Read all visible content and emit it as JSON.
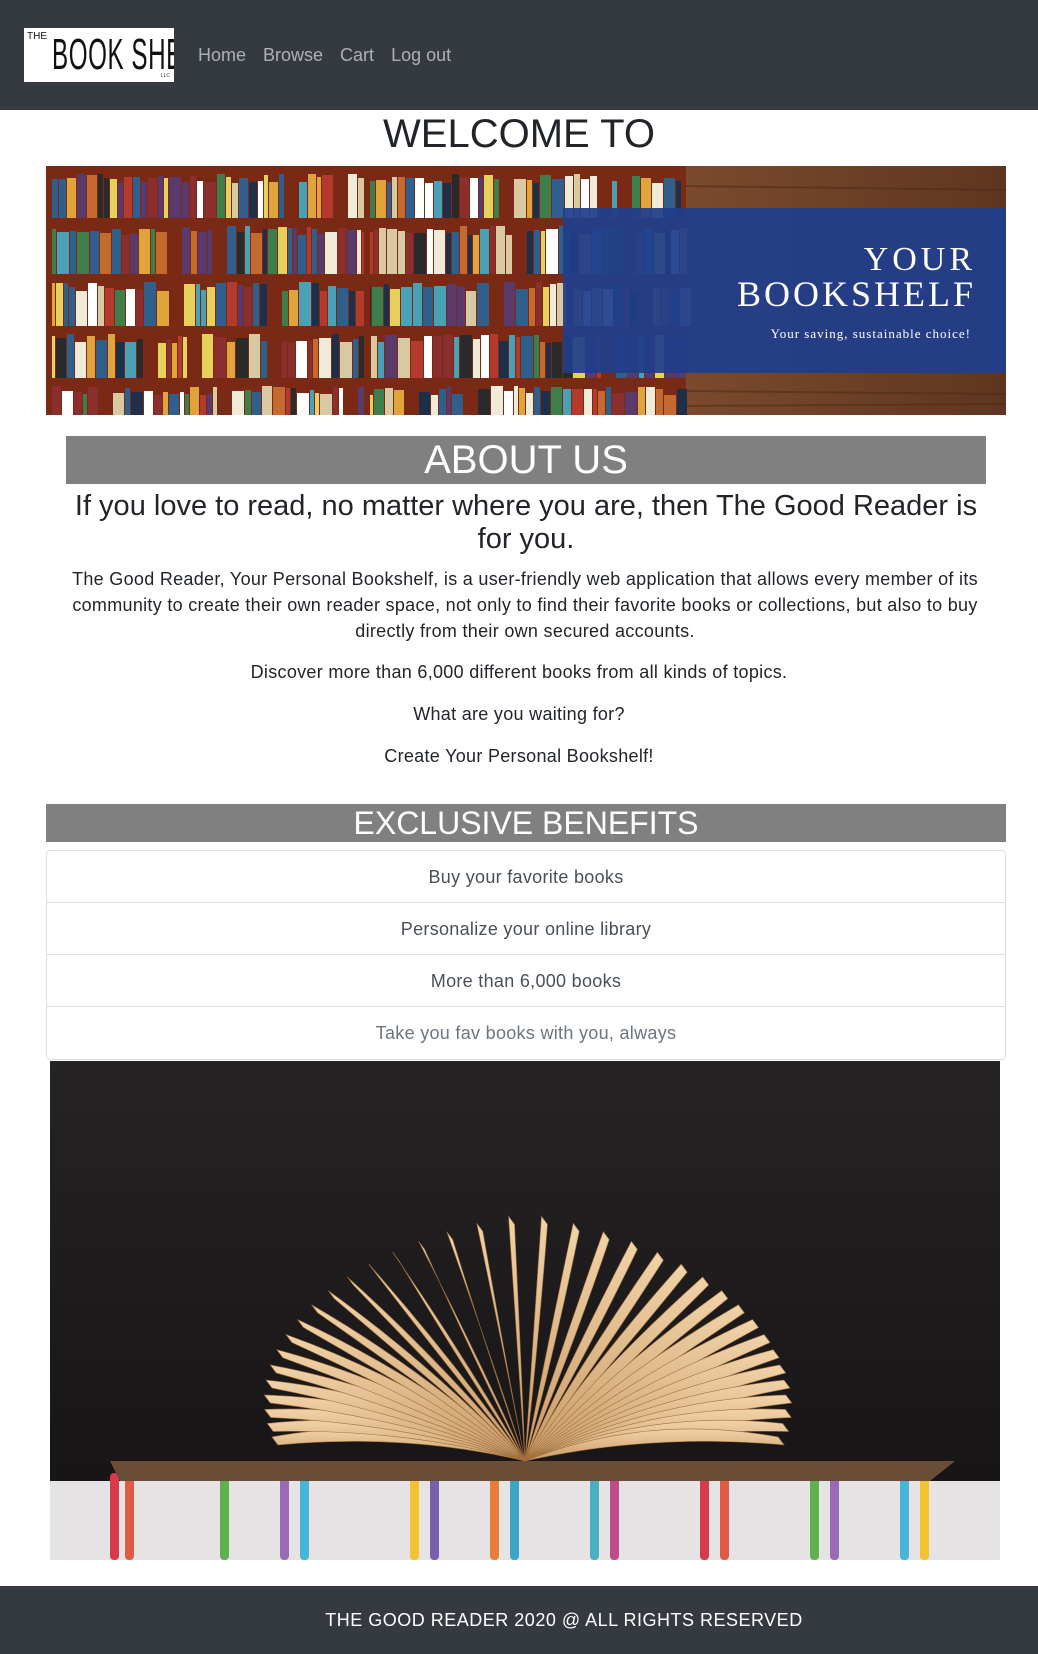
{
  "navbar": {
    "logo": {
      "the": "THE",
      "main": "BOOK SHELF",
      "llc": "LLC"
    },
    "links": [
      "Home",
      "Browse",
      "Cart",
      "Log out"
    ]
  },
  "welcome": "WELCOME TO",
  "banner": {
    "line1": "YOUR",
    "line2": "BOOKSHELF",
    "line3": "Your saving, sustainable choice!"
  },
  "about": {
    "heading": "ABOUT US",
    "tagline": "If you love to read, no matter where you are, then The Good Reader is for you.",
    "paragraph": "The Good Reader, Your Personal Bookshelf, is a user-friendly web application that allows every member of its community to create their own reader space, not only to find their favorite books or collections, but also to buy directly from their own secured accounts.",
    "discover": "Discover more than 6,000 different books from all kinds of topics.",
    "waiting": "What are you waiting for?",
    "create": "Create Your Personal Bookshelf!"
  },
  "benefits": {
    "heading": "EXCLUSIVE BENEFITS",
    "items": [
      "Buy your favorite books",
      "Personalize your online library",
      "More than 6,000 books",
      "Take you fav books with you, always"
    ]
  },
  "footer": {
    "text": "THE GOOD READER 2020 @ ALL RIGHTS RESERVED"
  },
  "colors": {
    "navbar": "#343a40",
    "section_bar": "#808080",
    "banner_panel": "#1f3d8c"
  }
}
